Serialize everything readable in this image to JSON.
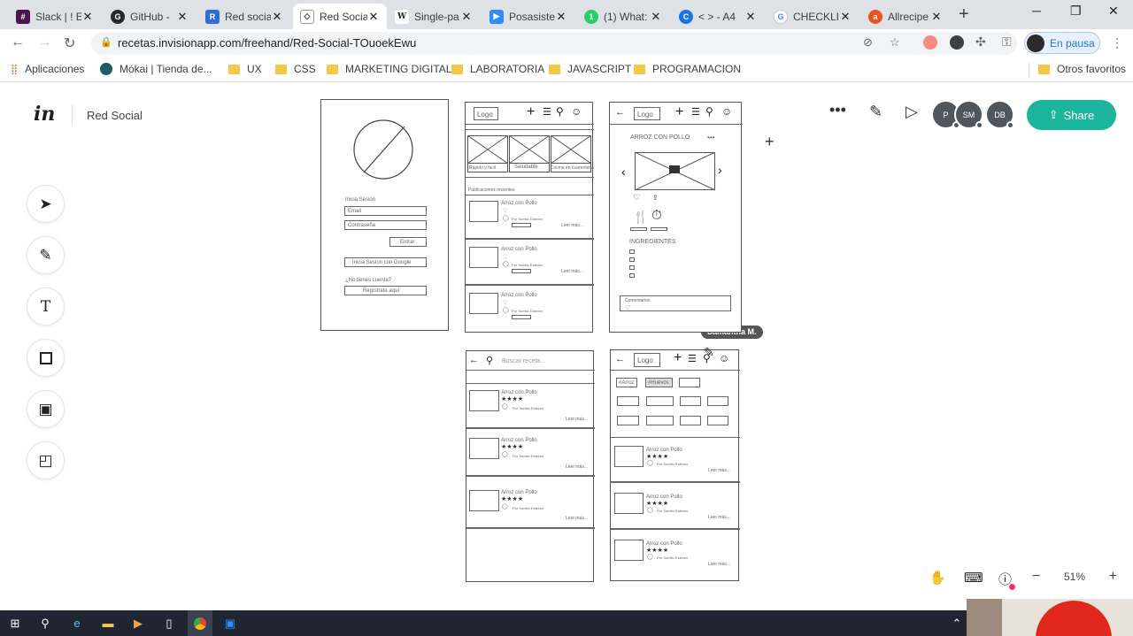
{
  "browser": {
    "tabs": [
      {
        "label": "Slack | ! E",
        "color": "#4a154b",
        "glyph": "#"
      },
      {
        "label": "GitHub -",
        "color": "#24292e",
        "glyph": "G"
      },
      {
        "label": "Red socia",
        "color": "#2f6cd5",
        "glyph": "R"
      },
      {
        "label": "Red Socia",
        "color": "#333333",
        "glyph": "in"
      },
      {
        "label": "Single-pa",
        "color": "#555555",
        "glyph": "W"
      },
      {
        "label": "Posasiste",
        "color": "#2d8cff",
        "glyph": "Z"
      },
      {
        "label": "(1) What:",
        "color": "#25d366",
        "glyph": "1"
      },
      {
        "label": "< > - A4",
        "color": "#1a73e8",
        "glyph": "C"
      },
      {
        "label": "CHECKLI",
        "color": "#4285f4",
        "glyph": "G"
      },
      {
        "label": "Allrecipe",
        "color": "#e8531f",
        "glyph": "a"
      }
    ],
    "url": "recetas.invisionapp.com/freehand/Red-Social-TOuoekEwu",
    "profile_label": "En pausa",
    "bookmarks": [
      {
        "label": "Aplicaciones",
        "icon": "apps-icon"
      },
      {
        "label": "Mókai | Tienda de...",
        "icon": "mokai-icon"
      },
      {
        "label": "UX",
        "icon": "folder-icon"
      },
      {
        "label": "CSS",
        "icon": "folder-icon"
      },
      {
        "label": "MARKETING DIGITAL",
        "icon": "folder-icon"
      },
      {
        "label": "LABORATORIA",
        "icon": "folder-icon"
      },
      {
        "label": "JAVASCRIPT",
        "icon": "folder-icon"
      },
      {
        "label": "PROGRAMACION",
        "icon": "folder-icon"
      }
    ],
    "other_bookmarks": "Otros favoritos"
  },
  "app": {
    "logo": "in",
    "project_name": "Red Social",
    "avatars": [
      "P",
      "SM",
      "DB"
    ],
    "share_label": "Share",
    "cursor_user": "Samantha M.",
    "zoom_level": "51%"
  },
  "wireframes": {
    "login": {
      "section": "Inicia Sesión",
      "email": "Email",
      "password": "Contraseña",
      "enter": "Entrar",
      "google": "Inicia Sesion con Google",
      "no_account": "¿No tienes cuenta?",
      "register": "Regístrate aquí"
    },
    "feed": {
      "logo": "Logo",
      "categories": [
        "Rápido y fácil",
        "Saludable",
        "Cocina en cuarentena"
      ],
      "recent": "Publicaciones recientes",
      "post_title": "Arroz con Pollo",
      "post_author": "Por Sumito Estevez",
      "read_more": "Leer más..."
    },
    "recipe": {
      "logo": "Logo",
      "title": "ARROZ CON POLLO",
      "ingredients_title": "INGREDIENTES",
      "comments": "Comentarios"
    },
    "search": {
      "placeholder": "Buscar receta...",
      "post_title": "Arroz con Pollo",
      "stars": "★★★★",
      "post_author": "Por Sumito Estevez",
      "read_more": "Leer más..."
    },
    "filter": {
      "logo": "Logo",
      "tags": [
        "#Arroz",
        "#Huevos"
      ],
      "post_title": "Arroz con Pollo",
      "stars": "★★★★",
      "post_author": "Por Sumito Estevez",
      "read_more": "Leer más..."
    }
  }
}
